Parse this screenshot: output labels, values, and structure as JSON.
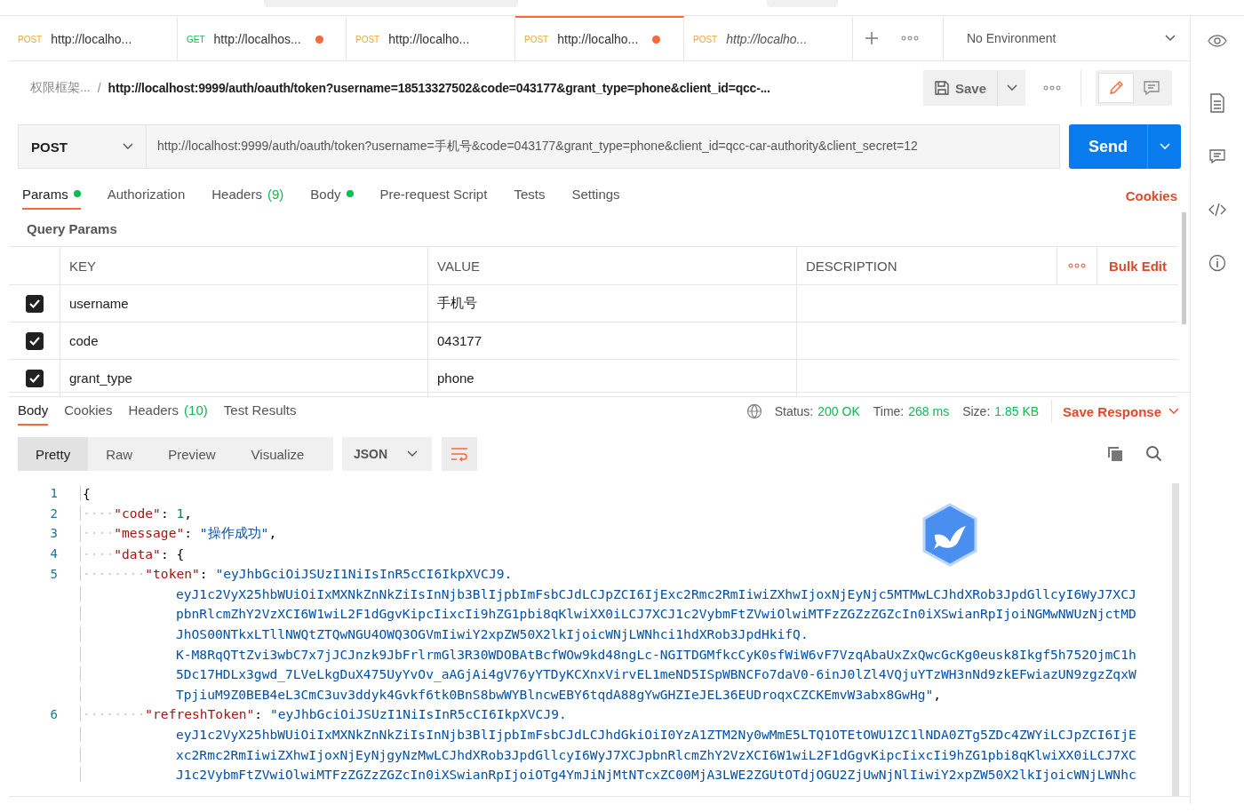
{
  "request_tabs": [
    {
      "method": "POST",
      "title": "http://localho...",
      "unsaved": false,
      "selected": false,
      "preview": false
    },
    {
      "method": "GET",
      "title": "http://localhos...",
      "unsaved": true,
      "selected": false,
      "preview": false
    },
    {
      "method": "POST",
      "title": "http://localho...",
      "unsaved": false,
      "selected": false,
      "preview": false
    },
    {
      "method": "POST",
      "title": "http://localho...",
      "unsaved": true,
      "selected": true,
      "preview": false
    },
    {
      "method": "POST",
      "title": "http://localho...",
      "unsaved": false,
      "selected": false,
      "preview": true
    }
  ],
  "environment": {
    "label": "No Environment"
  },
  "breadcrumb": {
    "collection": "权限框架...",
    "separator": "/",
    "url": "http://localhost:9999/auth/oauth/token?username=18513327502&code=043177&grant_type=phone&client_id=qcc-..."
  },
  "save_button": {
    "label": "Save"
  },
  "mode_toggle": [
    {
      "kind": "edit",
      "selected": true
    },
    {
      "kind": "comment",
      "selected": false
    }
  ],
  "request": {
    "method": "POST",
    "url": "http://localhost:9999/auth/oauth/token?username=手机号&code=043177&grant_type=phone&client_id=qcc-car-authority&client_secret=12"
  },
  "send_button": {
    "label": "Send"
  },
  "param_tabs": [
    {
      "label": "Params",
      "dot": true,
      "selected": true
    },
    {
      "label": "Authorization",
      "dot": false,
      "selected": false
    },
    {
      "label": "Headers",
      "count": "(9)",
      "dot": false,
      "selected": false
    },
    {
      "label": "Body",
      "dot": true,
      "selected": false
    },
    {
      "label": "Pre-request Script",
      "dot": false,
      "selected": false
    },
    {
      "label": "Tests",
      "dot": false,
      "selected": false
    },
    {
      "label": "Settings",
      "dot": false,
      "selected": false
    }
  ],
  "cookies_link": "Cookies",
  "query_params": {
    "title": "Query Params",
    "columns": [
      "KEY",
      "VALUE",
      "DESCRIPTION"
    ],
    "bulk_edit": "Bulk Edit",
    "rows": [
      {
        "checked": true,
        "key": "username",
        "value": "手机号"
      },
      {
        "checked": true,
        "key": "code",
        "value": "043177"
      },
      {
        "checked": true,
        "key": "grant_type",
        "value": "phone"
      }
    ]
  },
  "response": {
    "tabs": [
      {
        "label": "Body",
        "selected": true
      },
      {
        "label": "Cookies",
        "selected": false
      },
      {
        "label": "Headers",
        "count": "(10)",
        "selected": false
      },
      {
        "label": "Test Results",
        "selected": false
      }
    ],
    "status": [
      {
        "label": "Status:",
        "value": "200 OK"
      },
      {
        "label": "Time:",
        "value": "268 ms"
      },
      {
        "label": "Size:",
        "value": "1.85 KB"
      }
    ],
    "save_response": "Save Response",
    "view_modes": [
      {
        "label": "Pretty",
        "selected": true
      },
      {
        "label": "Raw",
        "selected": false
      },
      {
        "label": "Preview",
        "selected": false
      },
      {
        "label": "Visualize",
        "selected": false
      }
    ],
    "format": "JSON",
    "wrap_on": true,
    "lines": [
      {
        "number": "1",
        "tokens": [
          {
            "kind": "punct",
            "text": "{"
          }
        ]
      },
      {
        "number": "2",
        "tokens": [
          {
            "kind": "ws",
            "text": "····"
          },
          {
            "kind": "key",
            "text": "\"code\""
          },
          {
            "kind": "punct",
            "text": ": "
          },
          {
            "kind": "number",
            "text": "1"
          },
          {
            "kind": "punct",
            "text": ","
          }
        ]
      },
      {
        "number": "3",
        "tokens": [
          {
            "kind": "ws",
            "text": "····"
          },
          {
            "kind": "key",
            "text": "\"message\""
          },
          {
            "kind": "punct",
            "text": ": "
          },
          {
            "kind": "string",
            "text": "\"操作成功\""
          },
          {
            "kind": "punct",
            "text": ","
          }
        ]
      },
      {
        "number": "4",
        "tokens": [
          {
            "kind": "ws",
            "text": "····"
          },
          {
            "kind": "key",
            "text": "\"data\""
          },
          {
            "kind": "punct",
            "text": ": {"
          }
        ]
      },
      {
        "number": "5",
        "tokens": [
          {
            "kind": "ws",
            "text": "········"
          },
          {
            "kind": "key",
            "text": "\"token\""
          },
          {
            "kind": "punct",
            "text": ": "
          },
          {
            "kind": "string",
            "text": "\"eyJhbGciOiJSUzI1NiIsInR5cCI6IkpXVCJ9."
          }
        ],
        "continued": [
          [
            {
              "kind": "string",
              "text": "eyJ1c2VyX25hbWUiOiIxMXNkZnNkZiIsInNjb3BlIjpbImFsbCJdLCJpZCI6IjExc2Rmc2RmIiwiZXhwIjoxNjEyNjc5MTMwLCJhdXRob3JpdGllcyI6WyJ7XCJ"
            }
          ],
          [
            {
              "kind": "string",
              "text": "pbnRlcmZhY2VzXCI6W1wiL2F1dGgvKipcIixcIi9hZG1pbi8qKlwiXX0iLCJ7XCJ1c2VybmFtZVwiOlwiMTFzZGZzZGZcIn0iXSwianRpIjoiNGMwNWUzNjctMD"
            }
          ],
          [
            {
              "kind": "string",
              "text": "JhOS00NTkxLTllNWQtZTQwNGU4OWQ3OGVmIiwiY2xpZW50X2lkIjoicWNjLWNhci1hdXRob3JpdHkifQ."
            }
          ],
          [
            {
              "kind": "string",
              "text": "K-M8RqQTtZvi3wbC7x7jJCJnzk9JbFrlrmGl3R30WDOBAtBcfWOw9kd48ngLc-NGITDGMfkcCyK0sfWiW6vF7VzqAbaUxZxQwcGcKg0eusk8Ikgf5h752OjmC1h"
            }
          ],
          [
            {
              "kind": "string",
              "text": "5Dc17HDLx3gwd_7LVeLkgDuX475UyYvOv_aAGjAi4gV76yYTDyKCXnxVirvEL1meND5ISpWBNCFo7daV0-6inJ0lZl4VQjuYTzWH3nNd9zkEFwiazUN9zgzZqxW"
            }
          ],
          [
            {
              "kind": "string",
              "text": "TpjiuM9Z0BEB4eL3CmC3uv3ddyk4Gvkf6tk0BnS8bwWYBlncwEBY6tqdA88gYwGHZIeJEL36EUDroqxCZCKEmvW3abx8GwHg\""
            },
            {
              "kind": "punct",
              "text": ","
            }
          ]
        ]
      },
      {
        "number": "6",
        "tokens": [
          {
            "kind": "ws",
            "text": "········"
          },
          {
            "kind": "key",
            "text": "\"refreshToken\""
          },
          {
            "kind": "punct",
            "text": ": "
          },
          {
            "kind": "string",
            "text": "\"eyJhbGciOiJSUzI1NiIsInR5cCI6IkpXVCJ9."
          }
        ],
        "continued": [
          [
            {
              "kind": "string",
              "text": "eyJ1c2VyX25hbWUiOiIxMXNkZnNkZiIsInNjb3BlIjpbImFsbCJdLCJhdGkiOiI0YzA1ZTM2Ny0wMmE5LTQ1OTEtOWU1ZC1lNDA0ZTg5ZDc4ZWYiLCJpZCI6IjE"
            }
          ],
          [
            {
              "kind": "string",
              "text": "xc2Rmc2RmIiwiZXhwIjoxNjEyNjgyNzMwLCJhdXRob3JpdGllcyI6WyJ7XCJpbnRlcmZhY2VzXCI6W1wiL2F1dGgvKipcIixcIi9hZG1pbi8qKlwiXX0iLCJ7XC"
            }
          ],
          [
            {
              "kind": "string",
              "text": "J1c2VybmFtZVwiOlwiMTFzZGZzZGZcIn0iXSwianRpIjoiOTg4YmJiNjMtNTcxZC00MjA3LWE2ZGUtOTdjOGU2ZjUwNjNlIiwiY2xpZW50X2lkIjoicWNjLWNhc"
            }
          ]
        ]
      }
    ]
  }
}
